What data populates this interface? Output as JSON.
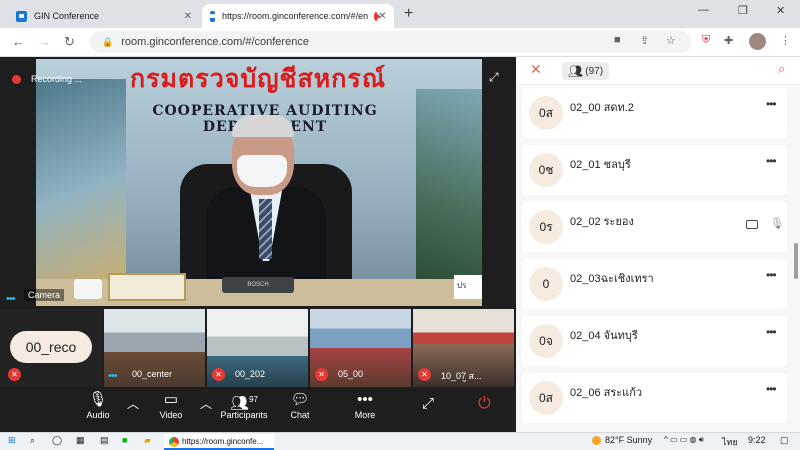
{
  "browser": {
    "tabs": [
      {
        "title": "GIN Conference",
        "close": "✕"
      },
      {
        "title": "https://room.ginconference.com/#/en",
        "close": "✕"
      }
    ],
    "new_tab": "+",
    "window_controls": {
      "minimize": "—",
      "restore": "❐",
      "close": "✕"
    },
    "nav": {
      "back": "←",
      "forward": "→",
      "reload": "↻"
    },
    "url": "room.ginconference.com/#/conference"
  },
  "conference": {
    "recording_label": "Recording ...",
    "main_video": {
      "banner_thai": "กรมตรวจบัญชีสหกรณ์",
      "banner_english": "COOPERATIVE AUDITING DEPARTMENT",
      "speaker_label": "Camera",
      "mic_brand": "BOSCH",
      "sign_text": "ปร"
    },
    "self_tile": {
      "name": "00_reco"
    },
    "thumbnails": [
      {
        "label": "00_center"
      },
      {
        "label": "00_202"
      },
      {
        "label": "05_00"
      },
      {
        "label": "10_07 ส..."
      }
    ],
    "controls": {
      "audio": "Audio",
      "video": "Video",
      "participants": "Participants",
      "participants_count": "97",
      "chat": "Chat",
      "more": "More"
    }
  },
  "participants_panel": {
    "count": "(97)",
    "items": [
      {
        "avatar": "0ส",
        "name": "02_00 สดท.2"
      },
      {
        "avatar": "0ช",
        "name": "02_01 ชลบุรี"
      },
      {
        "avatar": "0ร",
        "name": "02_02 ระยอง"
      },
      {
        "avatar": "0",
        "name": "02_03ฉะเชิงเทรา"
      },
      {
        "avatar": "0จ",
        "name": "02_04 จันทบุรี"
      },
      {
        "avatar": "0ส",
        "name": "02_06 สระแก้ว"
      }
    ]
  },
  "taskbar": {
    "chrome_item": "https://room.ginconfe...",
    "weather": "82°F  Sunny",
    "language": "ไทย",
    "time": "9:22"
  },
  "colors": {
    "accent": "#e06a4b",
    "record": "#e53935",
    "brand": "#1976d2"
  }
}
